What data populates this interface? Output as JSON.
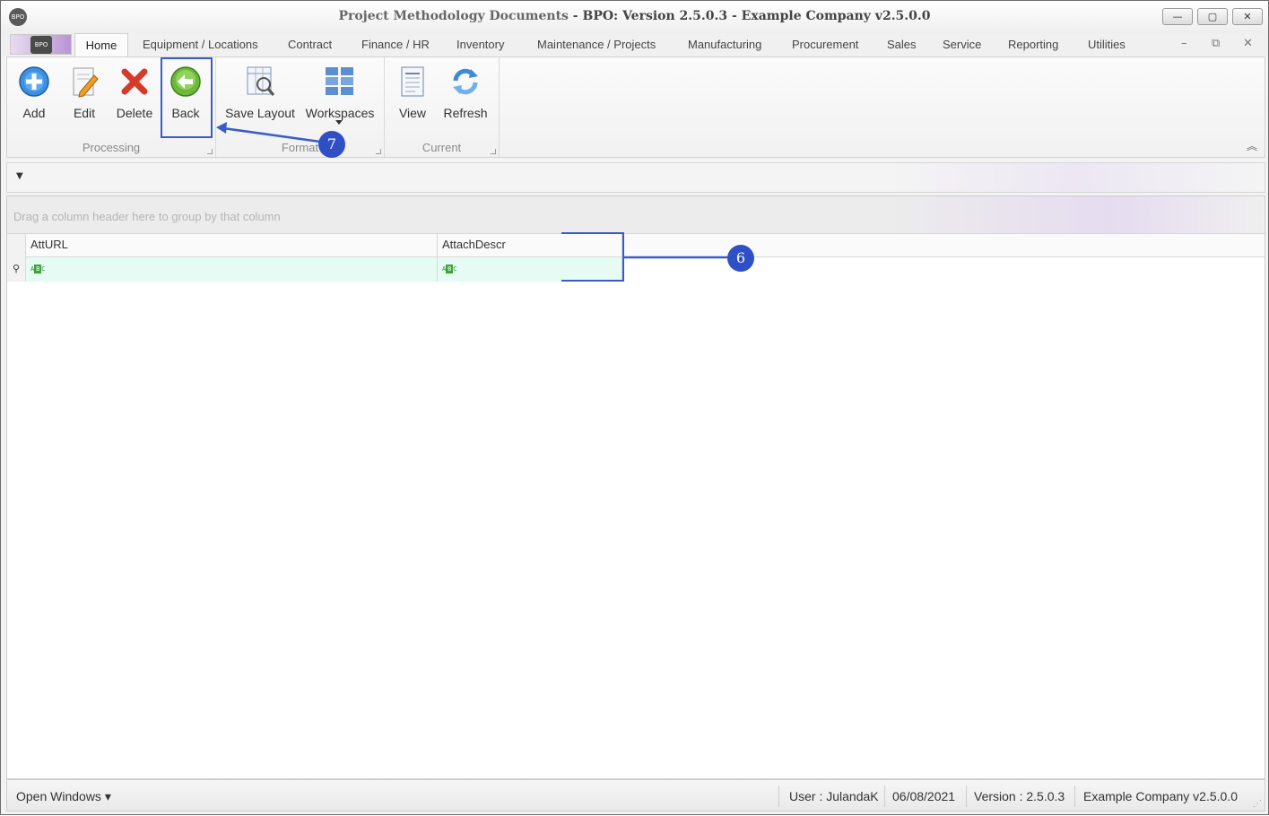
{
  "window": {
    "title_doc": "Project Methodology Documents",
    "title_sep": " - ",
    "title_app": "BPO: Version 2.5.0.3 - Example Company v2.5.0.0",
    "logo_text": "BPO",
    "minimize": "—",
    "maximize": "▢",
    "close": "✕"
  },
  "tabs": [
    "Home",
    "Equipment / Locations",
    "Contract",
    "Finance / HR",
    "Inventory",
    "Maintenance / Projects",
    "Manufacturing",
    "Procurement",
    "Sales",
    "Service",
    "Reporting",
    "Utilities"
  ],
  "mdi": {
    "minimize": "–",
    "restore": "⧉",
    "close": "✕"
  },
  "ribbon": {
    "groups": {
      "processing": "Processing",
      "format": "Format",
      "current": "Current"
    },
    "buttons": {
      "add": "Add",
      "edit": "Edit",
      "delete": "Delete",
      "back": "Back",
      "save_layout": "Save Layout",
      "workspaces": "Workspaces",
      "view": "View",
      "refresh": "Refresh"
    },
    "collapse": "︽"
  },
  "filterbar": {
    "toggle": "▼"
  },
  "grid": {
    "group_hint": "Drag a column header here to group by that column",
    "columns": [
      "AttURL",
      "AttachDescr"
    ],
    "filter_row_icon": "⚲",
    "abc_left": "A",
    "abc_mid": "B",
    "abc_right": "C"
  },
  "annotations": {
    "back_callout": "7",
    "columns_callout": "6"
  },
  "statusbar": {
    "open_windows": "Open Windows ▾",
    "user": "User : JulandaK",
    "date": "06/08/2021",
    "version": "Version : 2.5.0.3",
    "company": "Example Company v2.5.0.0",
    "grip": "⋰"
  }
}
